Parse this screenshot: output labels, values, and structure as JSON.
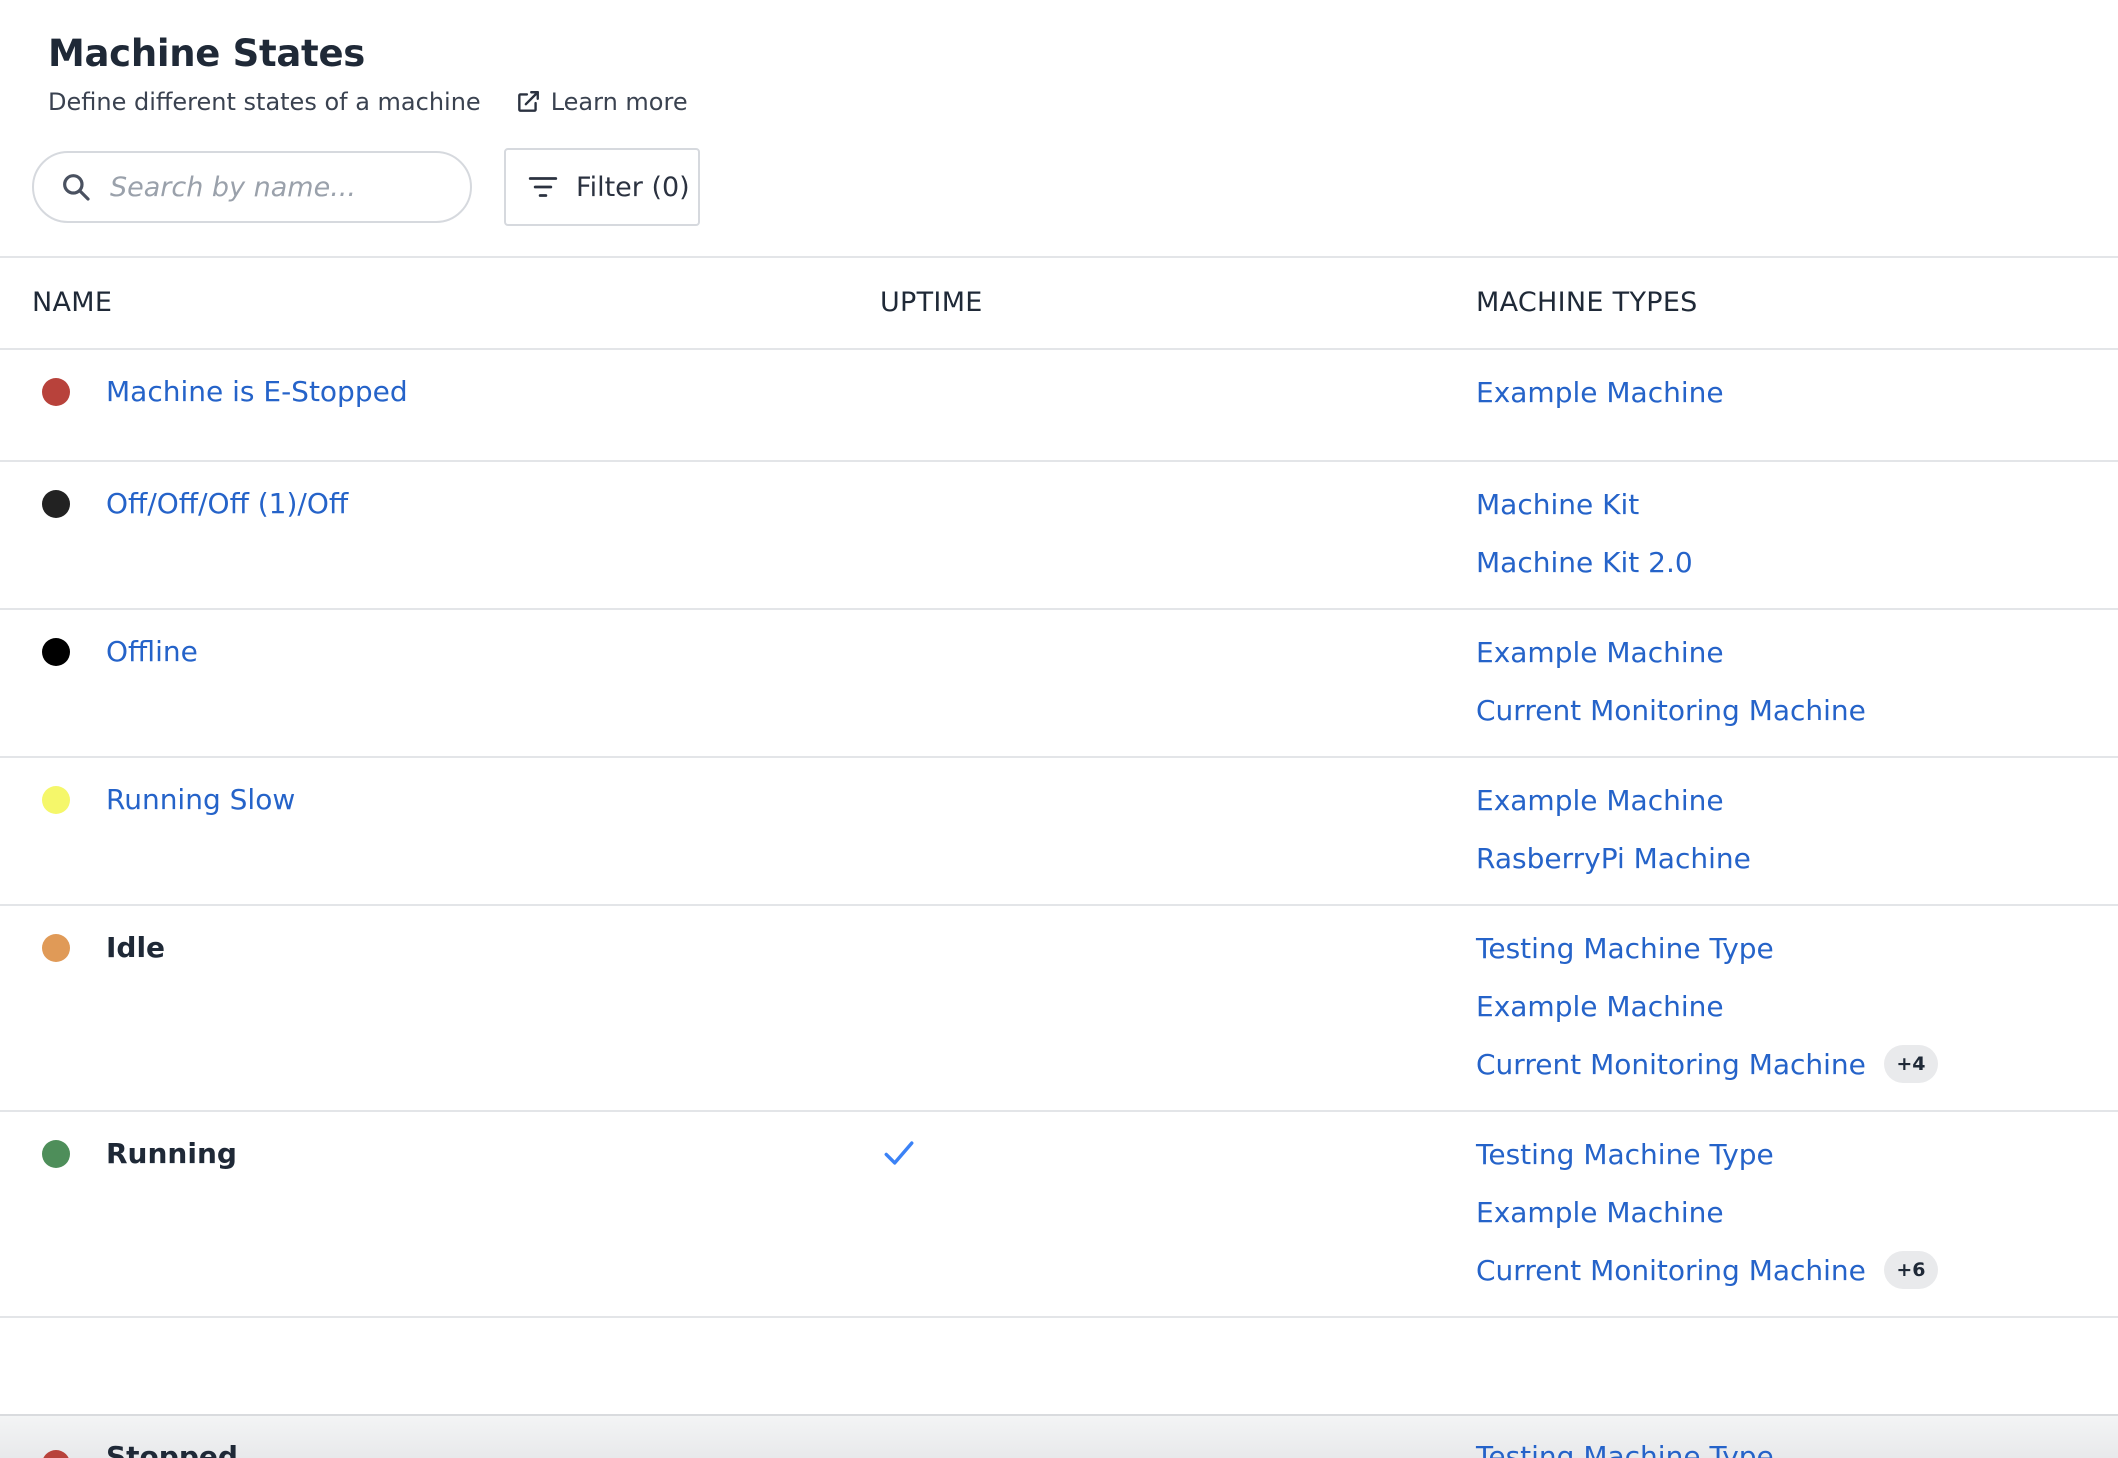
{
  "header": {
    "title": "Machine States",
    "subtitle": "Define different states of a machine",
    "learn_more": "Learn more"
  },
  "toolbar": {
    "search_placeholder": "Search by name...",
    "filter_label": "Filter (0)"
  },
  "table": {
    "columns": [
      "NAME",
      "UPTIME",
      "MACHINE TYPES"
    ],
    "rows": [
      {
        "name": "Machine is E-Stopped",
        "color": "#b8423b",
        "uptime": false,
        "types": [
          "Example Machine"
        ],
        "more": ""
      },
      {
        "name": "Off/Off/Off (1)/Off",
        "color": "#222222",
        "uptime": false,
        "types": [
          "Machine Kit",
          "Machine Kit 2.0"
        ],
        "more": ""
      },
      {
        "name": "Offline",
        "color": "#000000",
        "uptime": false,
        "types": [
          "Example Machine",
          "Current Monitoring Machine"
        ],
        "more": ""
      },
      {
        "name": "Running Slow",
        "color": "#f5f76a",
        "uptime": false,
        "types": [
          "Example Machine",
          "RasberryPi Machine"
        ],
        "more": ""
      },
      {
        "name": "Idle",
        "color": "#e09a57",
        "uptime": false,
        "types": [
          "Testing Machine Type",
          "Example Machine",
          "Current Monitoring Machine"
        ],
        "more": "+4"
      },
      {
        "name": "Running",
        "color": "#4e8e5a",
        "uptime": true,
        "types": [
          "Testing Machine Type",
          "Example Machine",
          "Current Monitoring Machine"
        ],
        "more": "+6"
      }
    ],
    "partial_row": {
      "name": "Stopped",
      "color": "#b8423b",
      "types": [
        "Testing Machine Type"
      ]
    }
  },
  "colors": {
    "link": "#2563c9",
    "check": "#3b82f6",
    "border": "#e3e5e8"
  },
  "icons": {
    "search": "search-icon",
    "filter": "filter-icon",
    "external": "external-link-icon",
    "check": "check-icon"
  }
}
